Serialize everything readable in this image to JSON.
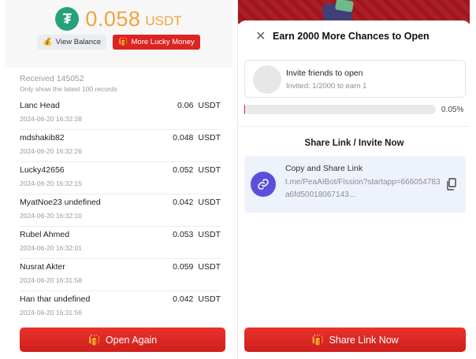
{
  "balance": {
    "amount": "0.058",
    "currency": "USDT",
    "logo_glyph": "₮",
    "logo_color": "#26a17b",
    "amount_color": "#f2a33a"
  },
  "actions": {
    "view_balance_label": "View Balance",
    "more_lucky_money_label": "More Lucky Money",
    "open_again_label": "Open Again"
  },
  "received": {
    "title": "Received 145052",
    "subtitle": "Only show the latest 100 records",
    "records": [
      {
        "name": "Lanc Head",
        "amount": "0.06",
        "currency": "USDT",
        "time": "2024-06-20 16:32:28"
      },
      {
        "name": "mdshakib82",
        "amount": "0.048",
        "currency": "USDT",
        "time": "2024-06-20 16:32:26"
      },
      {
        "name": "Lucky42656",
        "amount": "0.052",
        "currency": "USDT",
        "time": "2024-06-20 16:32:15"
      },
      {
        "name": "MyatNoe23 undefined",
        "amount": "0.042",
        "currency": "USDT",
        "time": "2024-06-20 16:32:10"
      },
      {
        "name": "Rubel Ahmed",
        "amount": "0.053",
        "currency": "USDT",
        "time": "2024-06-20 16:32:01"
      },
      {
        "name": "Nusrat Akter",
        "amount": "0.059",
        "currency": "USDT",
        "time": "2024-06-20 16:31:58"
      },
      {
        "name": "Han thar undefined",
        "amount": "0.042",
        "currency": "USDT",
        "time": "2024-06-20 16:31:56"
      }
    ]
  },
  "sheet": {
    "title": "Earn 2000 More Chances to Open",
    "invite_title": "Invite friends to open",
    "invite_sub": "Invited: 1/2000 to earn 1",
    "progress_fraction": 0.0005,
    "progress_label": "0.05%",
    "share_heading": "Share Link / Invite Now",
    "copy_title": "Copy and Share Link",
    "share_url": "t.me/PeaAIBot/Fission?startapp=666054783a6fd50018067143...",
    "share_button_label": "Share Link Now"
  },
  "colors": {
    "accent_red": "#dc2421",
    "link_icon_bg": "#5b4fdc"
  },
  "icons": {
    "balance_icon": "money-bag-icon",
    "gift_icon": "gift-icon",
    "close_icon": "close-icon",
    "link_icon": "link-icon",
    "copy_icon": "copy-icon"
  }
}
